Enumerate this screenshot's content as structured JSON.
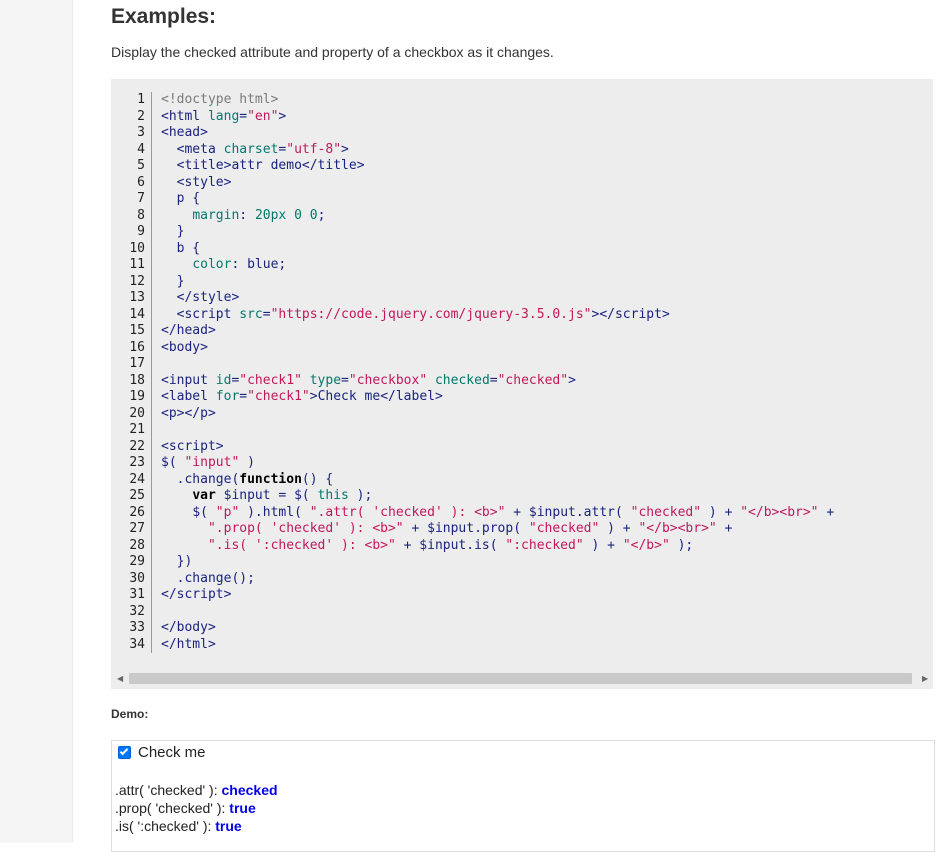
{
  "heading": "Examples:",
  "description": "Display the checked attribute and property of a checkbox as it changes.",
  "code_lines": [
    {
      "n": "1",
      "html": "<span class=\"cm\">&lt;!doctype html&gt;</span>"
    },
    {
      "n": "2",
      "html": "<span class=\"tag\">&lt;html</span> <span class=\"attr\">lang</span><span class=\"pl\">=</span><span class=\"str\">\"en\"</span><span class=\"tag\">&gt;</span>"
    },
    {
      "n": "3",
      "html": "<span class=\"tag\">&lt;head&gt;</span>"
    },
    {
      "n": "4",
      "html": "  <span class=\"tag\">&lt;meta</span> <span class=\"attr\">charset</span><span class=\"pl\">=</span><span class=\"str\">\"utf-8\"</span><span class=\"tag\">&gt;</span>"
    },
    {
      "n": "5",
      "html": "  <span class=\"tag\">&lt;title&gt;</span><span class=\"pl\">attr demo</span><span class=\"tag\">&lt;/title&gt;</span>"
    },
    {
      "n": "6",
      "html": "  <span class=\"tag\">&lt;style&gt;</span>"
    },
    {
      "n": "7",
      "html": "  <span class=\"pl\">p {</span>"
    },
    {
      "n": "8",
      "html": "    <span class=\"attr\">margin</span><span class=\"pl\">: </span><span class=\"attr\">20px 0 0</span><span class=\"pl\">;</span>"
    },
    {
      "n": "9",
      "html": "  <span class=\"pl\">}</span>"
    },
    {
      "n": "10",
      "html": "  <span class=\"pl\">b {</span>"
    },
    {
      "n": "11",
      "html": "    <span class=\"attr\">color</span><span class=\"pl\">: blue;</span>"
    },
    {
      "n": "12",
      "html": "  <span class=\"pl\">}</span>"
    },
    {
      "n": "13",
      "html": "  <span class=\"tag\">&lt;/style&gt;</span>"
    },
    {
      "n": "14",
      "html": "  <span class=\"tag\">&lt;script</span> <span class=\"attr\">src</span><span class=\"pl\">=</span><span class=\"str\">\"https://code.jquery.com/jquery-3.5.0.js\"</span><span class=\"tag\">&gt;&lt;/script&gt;</span>"
    },
    {
      "n": "15",
      "html": "<span class=\"tag\">&lt;/head&gt;</span>"
    },
    {
      "n": "16",
      "html": "<span class=\"tag\">&lt;body&gt;</span>"
    },
    {
      "n": "17",
      "html": ""
    },
    {
      "n": "18",
      "html": "<span class=\"tag\">&lt;input</span> <span class=\"attr\">id</span><span class=\"pl\">=</span><span class=\"str\">\"check1\"</span> <span class=\"attr\">type</span><span class=\"pl\">=</span><span class=\"str\">\"checkbox\"</span> <span class=\"attr\">checked</span><span class=\"pl\">=</span><span class=\"str\">\"checked\"</span><span class=\"tag\">&gt;</span>"
    },
    {
      "n": "19",
      "html": "<span class=\"tag\">&lt;label</span> <span class=\"attr\">for</span><span class=\"pl\">=</span><span class=\"str\">\"check1\"</span><span class=\"tag\">&gt;</span><span class=\"pl\">Check me</span><span class=\"tag\">&lt;/label&gt;</span>"
    },
    {
      "n": "20",
      "html": "<span class=\"tag\">&lt;p&gt;&lt;/p&gt;</span>"
    },
    {
      "n": "21",
      "html": ""
    },
    {
      "n": "22",
      "html": "<span class=\"tag\">&lt;script&gt;</span>"
    },
    {
      "n": "23",
      "html": "<span class=\"pl\">$( </span><span class=\"str\">\"input\"</span><span class=\"pl\"> )</span>"
    },
    {
      "n": "24",
      "html": "  <span class=\"pl\">.change(</span><span class=\"kw\">function</span><span class=\"pl\">() {</span>"
    },
    {
      "n": "25",
      "html": "    <span class=\"kw\">var</span> <span class=\"pl\">$input = $( </span><span class=\"attr\">this</span><span class=\"pl\"> );</span>"
    },
    {
      "n": "26",
      "html": "    <span class=\"pl\">$( </span><span class=\"str\">\"p\"</span><span class=\"pl\"> ).html( </span><span class=\"str\">\".attr( 'checked' ): &lt;b&gt;\"</span><span class=\"pl\"> + $input.attr( </span><span class=\"str\">\"checked\"</span><span class=\"pl\"> ) + </span><span class=\"str\">\"&lt;/b&gt;&lt;br&gt;\"</span><span class=\"pl\"> +</span>"
    },
    {
      "n": "27",
      "html": "      <span class=\"str\">\".prop( 'checked' ): &lt;b&gt;\"</span><span class=\"pl\"> + $input.prop( </span><span class=\"str\">\"checked\"</span><span class=\"pl\"> ) + </span><span class=\"str\">\"&lt;/b&gt;&lt;br&gt;\"</span><span class=\"pl\"> +</span>"
    },
    {
      "n": "28",
      "html": "      <span class=\"str\">\".is( ':checked' ): &lt;b&gt;\"</span><span class=\"pl\"> + $input.is( </span><span class=\"str\">\":checked\"</span><span class=\"pl\"> ) + </span><span class=\"str\">\"&lt;/b&gt;\"</span><span class=\"pl\"> );</span>"
    },
    {
      "n": "29",
      "html": "  <span class=\"pl\">})</span>"
    },
    {
      "n": "30",
      "html": "  <span class=\"pl\">.change();</span>"
    },
    {
      "n": "31",
      "html": "<span class=\"tag\">&lt;/script&gt;</span>"
    },
    {
      "n": "32",
      "html": ""
    },
    {
      "n": "33",
      "html": "<span class=\"tag\">&lt;/body&gt;</span>"
    },
    {
      "n": "34",
      "html": "<span class=\"tag\">&lt;/html&gt;</span>"
    }
  ],
  "demo": {
    "label": "Demo:",
    "checkbox_checked": true,
    "checkbox_label": "Check me",
    "output": [
      {
        "prefix": ".attr( 'checked' ): ",
        "value": "checked"
      },
      {
        "prefix": ".prop( 'checked' ): ",
        "value": "true"
      },
      {
        "prefix": ".is( ':checked' ): ",
        "value": "true"
      }
    ]
  },
  "colors": {
    "code_bg": "#ededed",
    "checkbox_accent": "#0075ff",
    "output_bold": "#0000ee"
  },
  "icons": {
    "scroll_left": "arrow-left-icon",
    "scroll_right": "arrow-right-icon"
  }
}
